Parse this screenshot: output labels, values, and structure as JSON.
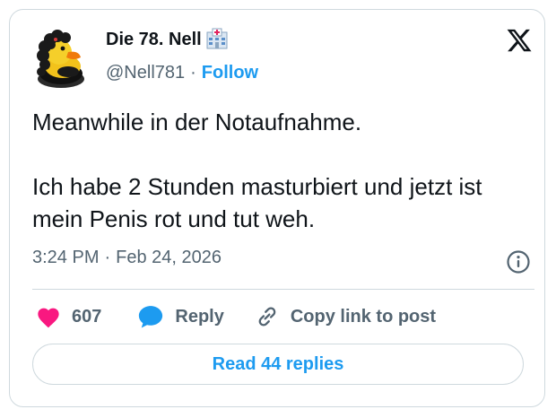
{
  "author": {
    "display_name": "Die 78. Nell",
    "handle": "@Nell781",
    "separator": "·",
    "follow_label": "Follow"
  },
  "tweet": {
    "lines": [
      "Meanwhile in der Notaufnahme.",
      "Ich habe 2 Stunden masturbiert und jetzt ist mein Penis rot und tut weh."
    ],
    "time": "3:24 PM",
    "meta_separator": "·",
    "date": "Feb 24, 2026"
  },
  "actions": {
    "like_count": "607",
    "reply_label": "Reply",
    "copy_link_label": "Copy link to post"
  },
  "read_replies_label": "Read 44 replies",
  "icons": [
    "duck-avatar",
    "hospital-icon",
    "x-logo-icon",
    "info-icon",
    "heart-icon",
    "reply-bubble-icon",
    "link-icon"
  ],
  "colors": {
    "accent": "#1d9bf0",
    "like": "#f91880",
    "text": "#0f1419",
    "muted": "#536471",
    "border": "#cfd9de"
  }
}
